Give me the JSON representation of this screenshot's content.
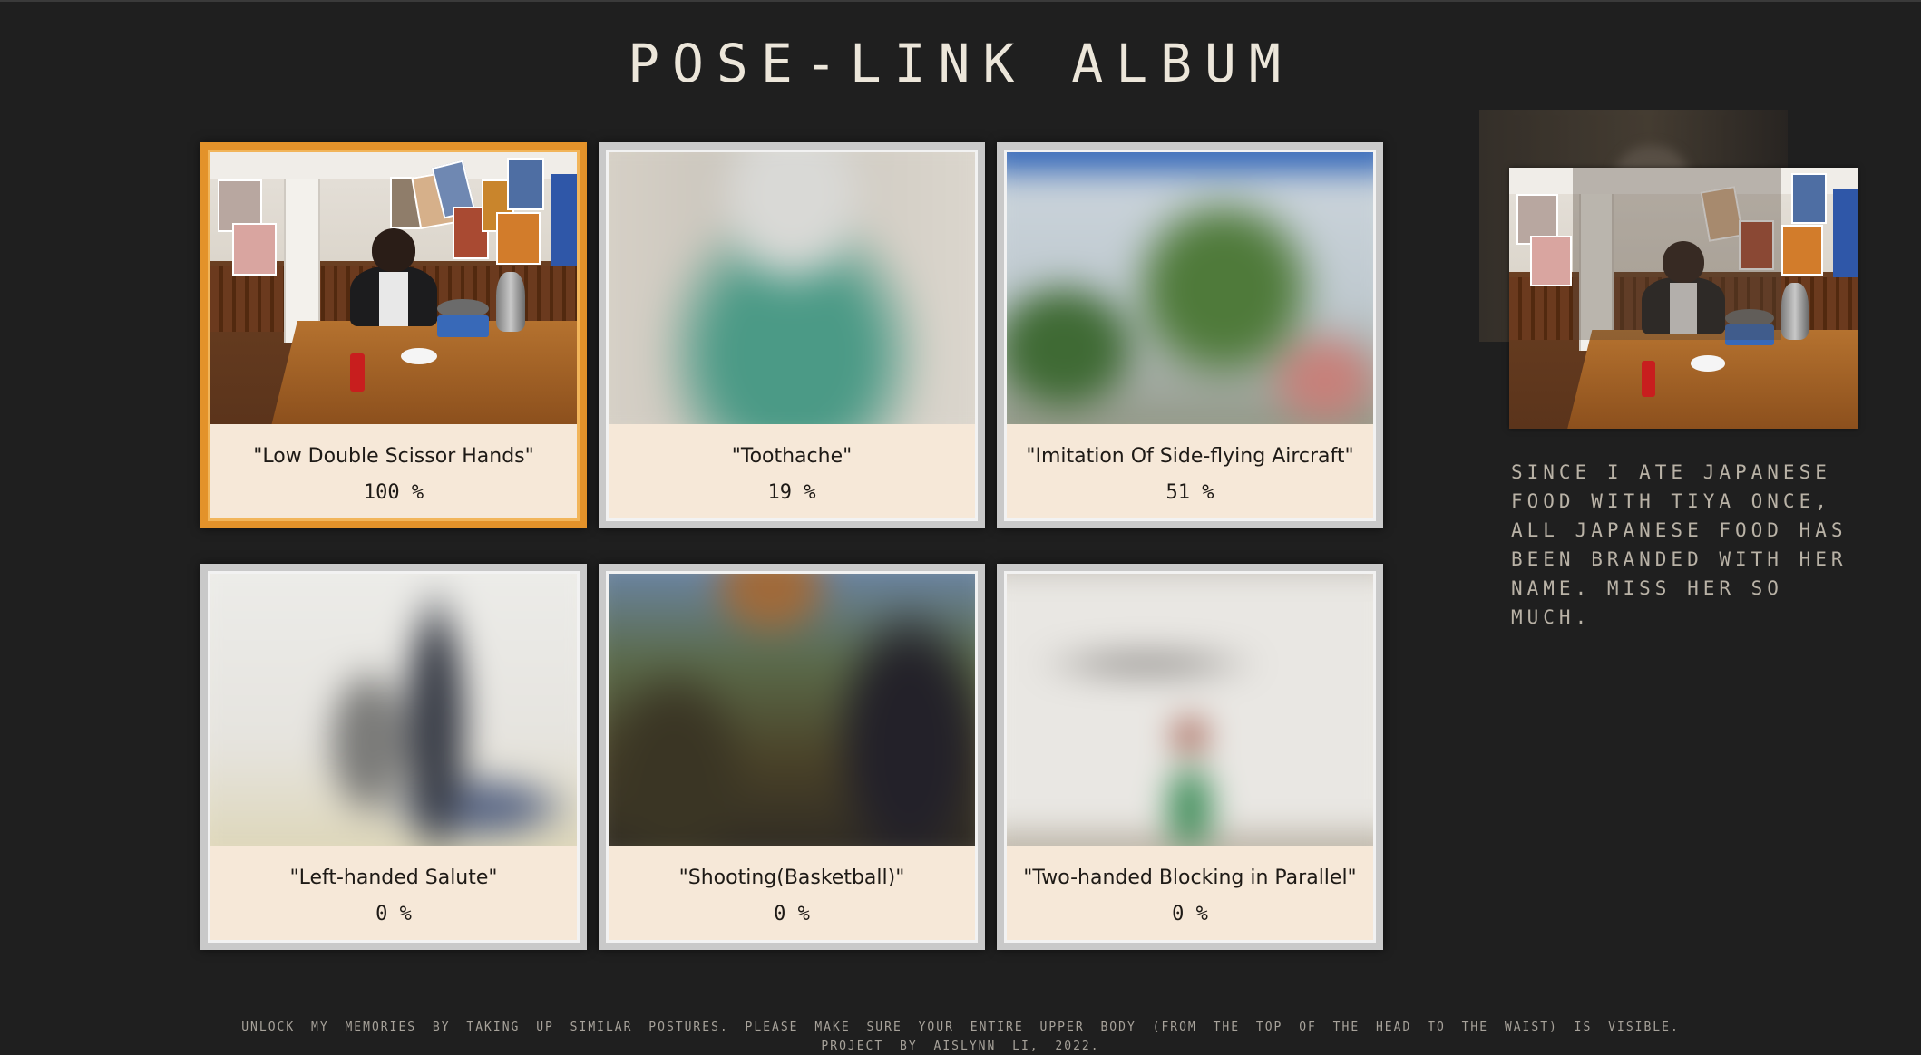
{
  "page": {
    "title": "POSE-LINK ALBUM"
  },
  "cards": [
    {
      "label": "\"Low Double Scissor Hands\"",
      "progress": "100 %",
      "active": true,
      "photo": "restaurant-photo"
    },
    {
      "label": "\"Toothache\"",
      "progress": "19 %",
      "active": false,
      "photo": "blurred-photo"
    },
    {
      "label": "\"Imitation Of Side-flying Aircraft\"",
      "progress": "51 %",
      "active": false,
      "photo": "blurred-photo"
    },
    {
      "label": "\"Left-handed Salute\"",
      "progress": "0 %",
      "active": false,
      "photo": "blurred-photo"
    },
    {
      "label": "\"Shooting(Basketball)\"",
      "progress": "0 %",
      "active": false,
      "photo": "blurred-photo"
    },
    {
      "label": "\"Two-handed Blocking in Parallel\"",
      "progress": "0 %",
      "active": false,
      "photo": "blurred-photo"
    }
  ],
  "preview": {
    "caption": "Since I ate Japanese food with Tiya once, all Japanese food has been branded with her name. Miss her so much."
  },
  "footer": {
    "instructions": "Unlock my memories by taking up similar postures. Please make sure your entire upper body (from the top of the head to the waist) is visible.",
    "credit": "Project by Aislynn Li, 2022."
  },
  "colors": {
    "background": "#1f1f1f",
    "active_border": "#e3922a",
    "card_border": "#c9c9c9",
    "card_fill": "#f6e8d8"
  }
}
